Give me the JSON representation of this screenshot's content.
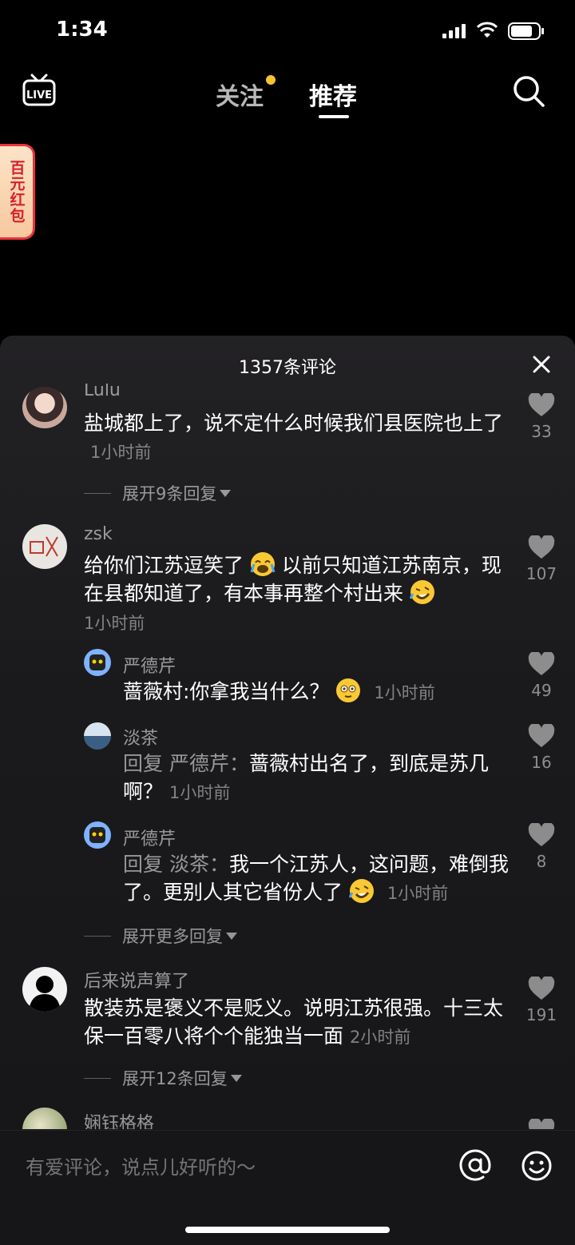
{
  "status": {
    "time": "1:34"
  },
  "nav": {
    "live_label": "LIVE",
    "tab_follow": "关注",
    "tab_recommend": "推荐"
  },
  "red_packet": {
    "label": "百元红包"
  },
  "panel": {
    "title": "1357条评论",
    "comments": [
      {
        "user": "Lulu",
        "text": "盐城都上了，说不定什么时候我们县医院也上了",
        "time": "1小时前",
        "likes": "33",
        "expand": "展开9条回复"
      },
      {
        "user": "zsk",
        "text_a": "给你们江苏逗笑了",
        "text_b": "以前只知道江苏南京，现在县都知道了，有本事再整个村出来",
        "time": "1小时前",
        "likes": "107",
        "replies": [
          {
            "user": "严德芹",
            "text": "蔷薇村:你拿我当什么？",
            "time": "1小时前",
            "likes": "49"
          },
          {
            "user": "淡茶",
            "prefix": "回复 严德芹：",
            "text": "蔷薇村出名了，到底是苏几啊？",
            "time": "1小时前",
            "likes": "16"
          },
          {
            "user": "严德芹",
            "prefix": "回复 淡茶：",
            "text": "我一个江苏人，这问题，难倒我了。更别人其它省份人了",
            "time": "1小时前",
            "likes": "8"
          }
        ],
        "expand": "展开更多回复"
      },
      {
        "user": "后来说声算了",
        "text": "散装苏是褒义不是贬义。说明江苏很强。十三太保一百零八将个个能独当一面",
        "time": "2小时前",
        "likes": "191",
        "expand": "展开12条回复"
      },
      {
        "user": "娴钰格格"
      }
    ]
  },
  "input": {
    "placeholder": "有爱评论，说点儿好听的～"
  },
  "colors": {
    "background": "#000000",
    "panel": "#1c1c1e",
    "badge_dot": "#f7c32e",
    "red_packet": "#e8343a"
  }
}
